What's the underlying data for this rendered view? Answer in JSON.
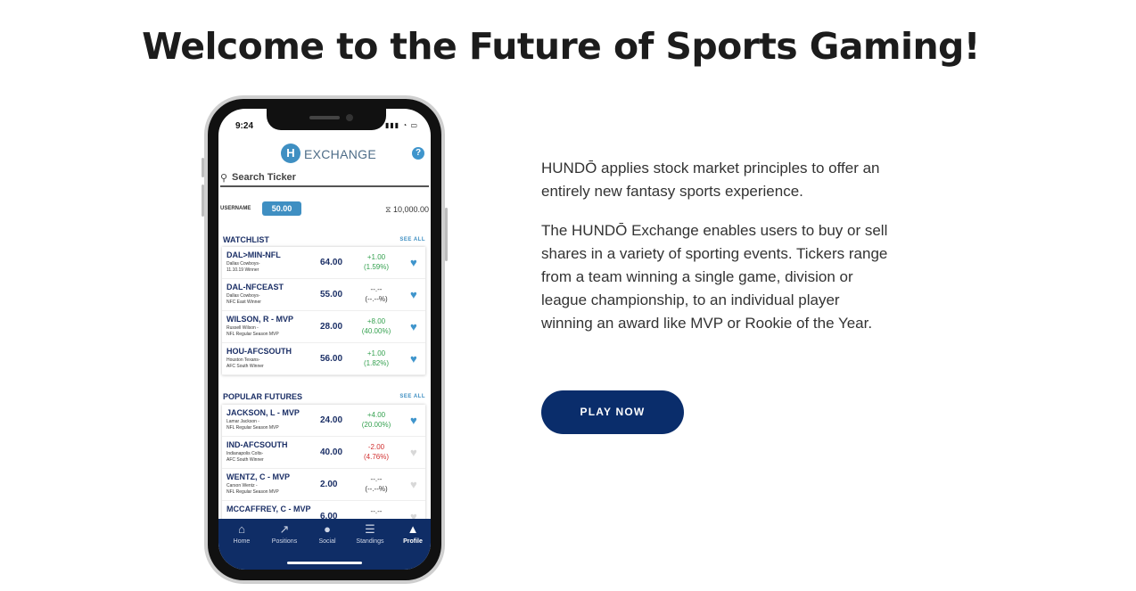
{
  "headline": "Welcome to the Future of Sports Gaming!",
  "phone": {
    "status_time": "9:24",
    "app_name": "EXCHANGE",
    "logo_glyph": "H",
    "help_glyph": "?",
    "search_placeholder": "Search Ticker",
    "username_label": "USERNAME",
    "username_value": "50.00",
    "balance": "⧖ 10,000.00",
    "watchlist_title": "WATCHLIST",
    "popular_title": "POPULAR FUTURES",
    "see_all": "SEE ALL",
    "watchlist": [
      {
        "ticker": "DAL>MIN-NFL",
        "desc1": "Dallas Cowboys-",
        "desc2": "11.10.19 Winner",
        "price": "64.00",
        "change": "+1.00",
        "pct": "(1.59%)",
        "dir": "up",
        "fav": true
      },
      {
        "ticker": "DAL-NFCEAST",
        "desc1": "Dallas Cowboys-",
        "desc2": "NFC East Winner",
        "price": "55.00",
        "change": "--.--",
        "pct": "(--.--%)",
        "dir": "flat",
        "fav": true
      },
      {
        "ticker": "WILSON, R - MVP",
        "desc1": "Russell Wilson -",
        "desc2": "NFL Regular Season MVP",
        "price": "28.00",
        "change": "+8.00",
        "pct": "(40.00%)",
        "dir": "up",
        "fav": true
      },
      {
        "ticker": "HOU-AFCSOUTH",
        "desc1": "Houston Texans-",
        "desc2": "AFC South Winner",
        "price": "56.00",
        "change": "+1.00",
        "pct": "(1.82%)",
        "dir": "up",
        "fav": true
      }
    ],
    "popular": [
      {
        "ticker": "JACKSON, L - MVP",
        "desc1": "Lamar Jackson -",
        "desc2": "NFL Regular Season MVP",
        "price": "24.00",
        "change": "+4.00",
        "pct": "(20.00%)",
        "dir": "up",
        "fav": true
      },
      {
        "ticker": "IND-AFCSOUTH",
        "desc1": "Indianapolis Colts-",
        "desc2": "AFC South Winner",
        "price": "40.00",
        "change": "-2.00",
        "pct": "(4.76%)",
        "dir": "down",
        "fav": false
      },
      {
        "ticker": "WENTZ, C - MVP",
        "desc1": "Carson Wentz -",
        "desc2": "NFL Regular Season MVP",
        "price": "2.00",
        "change": "--.--",
        "pct": "(--.--%)",
        "dir": "flat",
        "fav": false
      },
      {
        "ticker": "MCCAFFREY, C - MVP",
        "desc1": "",
        "desc2": "",
        "price": "6.00",
        "change": "--.--",
        "pct": "",
        "dir": "flat",
        "fav": false
      }
    ],
    "nav": [
      {
        "label": "Home",
        "icon": "home-icon",
        "glyph": "⌂"
      },
      {
        "label": "Positions",
        "icon": "chart-icon",
        "glyph": "↗"
      },
      {
        "label": "Social",
        "icon": "chat-icon",
        "glyph": "●"
      },
      {
        "label": "Standings",
        "icon": "list-icon",
        "glyph": "☰"
      },
      {
        "label": "Profile",
        "icon": "user-icon",
        "glyph": "▲"
      }
    ],
    "active_nav": "Profile"
  },
  "copy": {
    "paragraph1": "HUNDŌ applies stock market principles to offer an entirely new fantasy sports experience.",
    "paragraph2": "The HUNDŌ Exchange enables users to buy or sell shares in a variety of sporting events. Tickers range from a team winning a single game, division or league championship, to an individual player winning an award like MVP or Rookie of the Year."
  },
  "cta": {
    "label": "PLAY NOW"
  },
  "colors": {
    "brand_navy": "#0a2d6b",
    "accent_blue": "#3f8fc2",
    "positive": "#35a150",
    "negative": "#d13030"
  }
}
